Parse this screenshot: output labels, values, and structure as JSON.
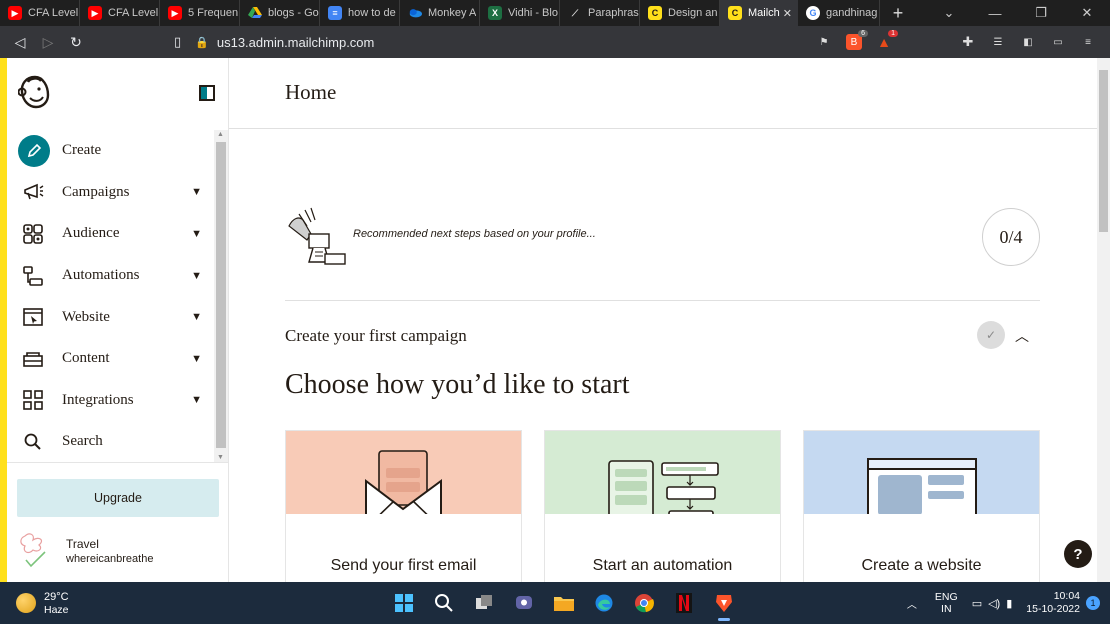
{
  "browser": {
    "tabs": [
      {
        "title": "CFA Level",
        "icon": "youtube-icon",
        "color": "#ff0000"
      },
      {
        "title": "CFA Level",
        "icon": "youtube-icon",
        "color": "#ff0000"
      },
      {
        "title": "5 Frequen",
        "icon": "youtube-icon",
        "color": "#ff0000"
      },
      {
        "title": "blogs - Go",
        "icon": "google-drive-icon",
        "color": "#34a853"
      },
      {
        "title": "how to de",
        "icon": "google-docs-icon",
        "color": "#4285f4"
      },
      {
        "title": "Monkey A",
        "icon": "onedrive-icon",
        "color": "#0a64d8"
      },
      {
        "title": "Vidhi - Blo",
        "icon": "excel-icon",
        "color": "#1d6f42"
      },
      {
        "title": "Paraphras",
        "icon": "quillbot-icon",
        "color": "#2d2d2d"
      },
      {
        "title": "Design an",
        "icon": "mailchimp-icon",
        "color": "#ffe01b"
      },
      {
        "title": "Mailch",
        "icon": "mailchimp-icon",
        "color": "#ffe01b"
      },
      {
        "title": "gandhinag",
        "icon": "google-icon",
        "color": "#ffffff"
      }
    ],
    "new_tab": "+",
    "url": "us13.admin.mailchimp.com",
    "brave_badge": "6",
    "alert_badge": "1"
  },
  "sidebar": {
    "items": [
      {
        "label": "Create",
        "icon": "pencil-icon"
      },
      {
        "label": "Campaigns",
        "icon": "megaphone-icon"
      },
      {
        "label": "Audience",
        "icon": "audience-icon"
      },
      {
        "label": "Automations",
        "icon": "automation-icon"
      },
      {
        "label": "Website",
        "icon": "website-icon"
      },
      {
        "label": "Content",
        "icon": "content-icon"
      },
      {
        "label": "Integrations",
        "icon": "grid-icon"
      },
      {
        "label": "Search",
        "icon": "search-icon"
      }
    ],
    "upgrade_label": "Upgrade",
    "account": {
      "name": "Travel",
      "username": "whereicanbreathe"
    }
  },
  "main": {
    "title": "Home",
    "recommend_text": "Recommended next steps based on your profile...",
    "progress": "0/4",
    "section_title": "Create your first campaign",
    "heading": "Choose how you’d like to start",
    "cards": [
      {
        "label": "Send your first email",
        "bg": "#f8cbb7"
      },
      {
        "label": "Start an automation",
        "bg": "#d5ebd3"
      },
      {
        "label": "Create a website",
        "bg": "#c5d9f1"
      }
    ],
    "help": "?"
  },
  "taskbar": {
    "temperature": "29°C",
    "condition": "Haze",
    "language": "ENG",
    "region": "IN",
    "time": "10:04",
    "date": "15-10-2022",
    "notification_count": "1"
  }
}
